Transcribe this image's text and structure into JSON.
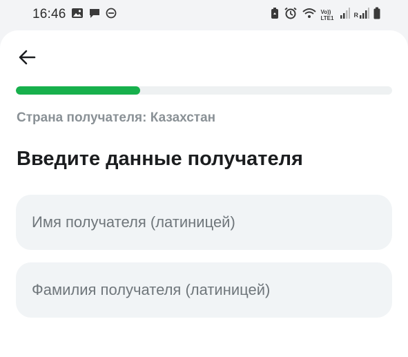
{
  "status_bar": {
    "time": "16:46",
    "network_label": "Vo)) LTE1",
    "sim_label": "R",
    "left_icons": [
      "gallery-icon",
      "chat-icon",
      "do-not-disturb-icon"
    ],
    "right_icons": [
      "battery-saver-icon",
      "alarm-icon",
      "wifi-icon",
      "signal-icon",
      "signal-icon",
      "battery-icon"
    ]
  },
  "header": {
    "back_icon": "arrow-left-icon"
  },
  "progress": {
    "fraction": 0.33,
    "color": "#17b04c",
    "track_color": "#eef1f2"
  },
  "recipient": {
    "country_line": "Страна получателя: Казахстан",
    "title": "Введите данные получателя",
    "first_name": {
      "value": "",
      "placeholder": "Имя получателя (латиницей)"
    },
    "last_name": {
      "value": "",
      "placeholder": "Фамилия получателя (латиницей)"
    }
  }
}
